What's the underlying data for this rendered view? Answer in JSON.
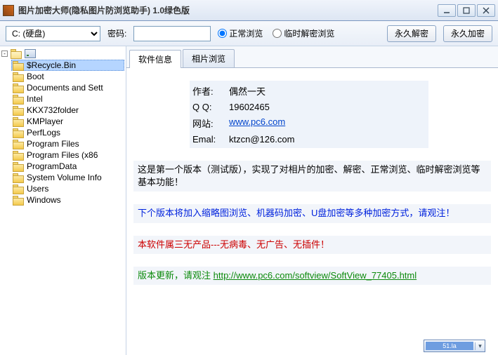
{
  "window": {
    "title": "图片加密大师(隐私图片防浏览助手) 1.0绿色版"
  },
  "toolbar": {
    "drive_selected": "C: (硬盘)",
    "pwd_label": "密码:",
    "radio_normal": "正常浏览",
    "radio_temp": "临时解密浏览",
    "btn_decrypt": "永久解密",
    "btn_encrypt": "永久加密"
  },
  "tree": {
    "root_label": "",
    "items": [
      {
        "label": "$Recycle.Bin"
      },
      {
        "label": "Boot"
      },
      {
        "label": "Documents and Sett"
      },
      {
        "label": "Intel"
      },
      {
        "label": "KKX732folder"
      },
      {
        "label": "KMPlayer"
      },
      {
        "label": "PerfLogs"
      },
      {
        "label": "Program Files"
      },
      {
        "label": "Program Files (x86"
      },
      {
        "label": "ProgramData"
      },
      {
        "label": "System Volume Info"
      },
      {
        "label": "Users"
      },
      {
        "label": "Windows"
      }
    ]
  },
  "tabs": {
    "tab_info": "软件信息",
    "tab_photo": "相片浏览"
  },
  "info": {
    "author_label": "作者:",
    "author_value": "偶然一天",
    "qq_label": "Q  Q:",
    "qq_value": "19602465",
    "site_label": "网站:",
    "site_value": "www.pc6.com",
    "email_label": "Emal:",
    "email_value": "ktzcn@126.com"
  },
  "paras": {
    "p1": "这是第一个版本（测试版），实现了对相片的加密、解密、正常浏览、临时解密浏览等基本功能！",
    "p2": "下个版本将加入缩略图浏览、机器码加密、U盘加密等多种加密方式，请观注！",
    "p3": "本软件属三无产品---无病毒、无广告、无插件！",
    "p4_pre": "版本更新，请观注 ",
    "p4_link": "http://www.pc6.com/softview/SoftView_77405.html"
  },
  "widget": {
    "text": "51.la"
  }
}
